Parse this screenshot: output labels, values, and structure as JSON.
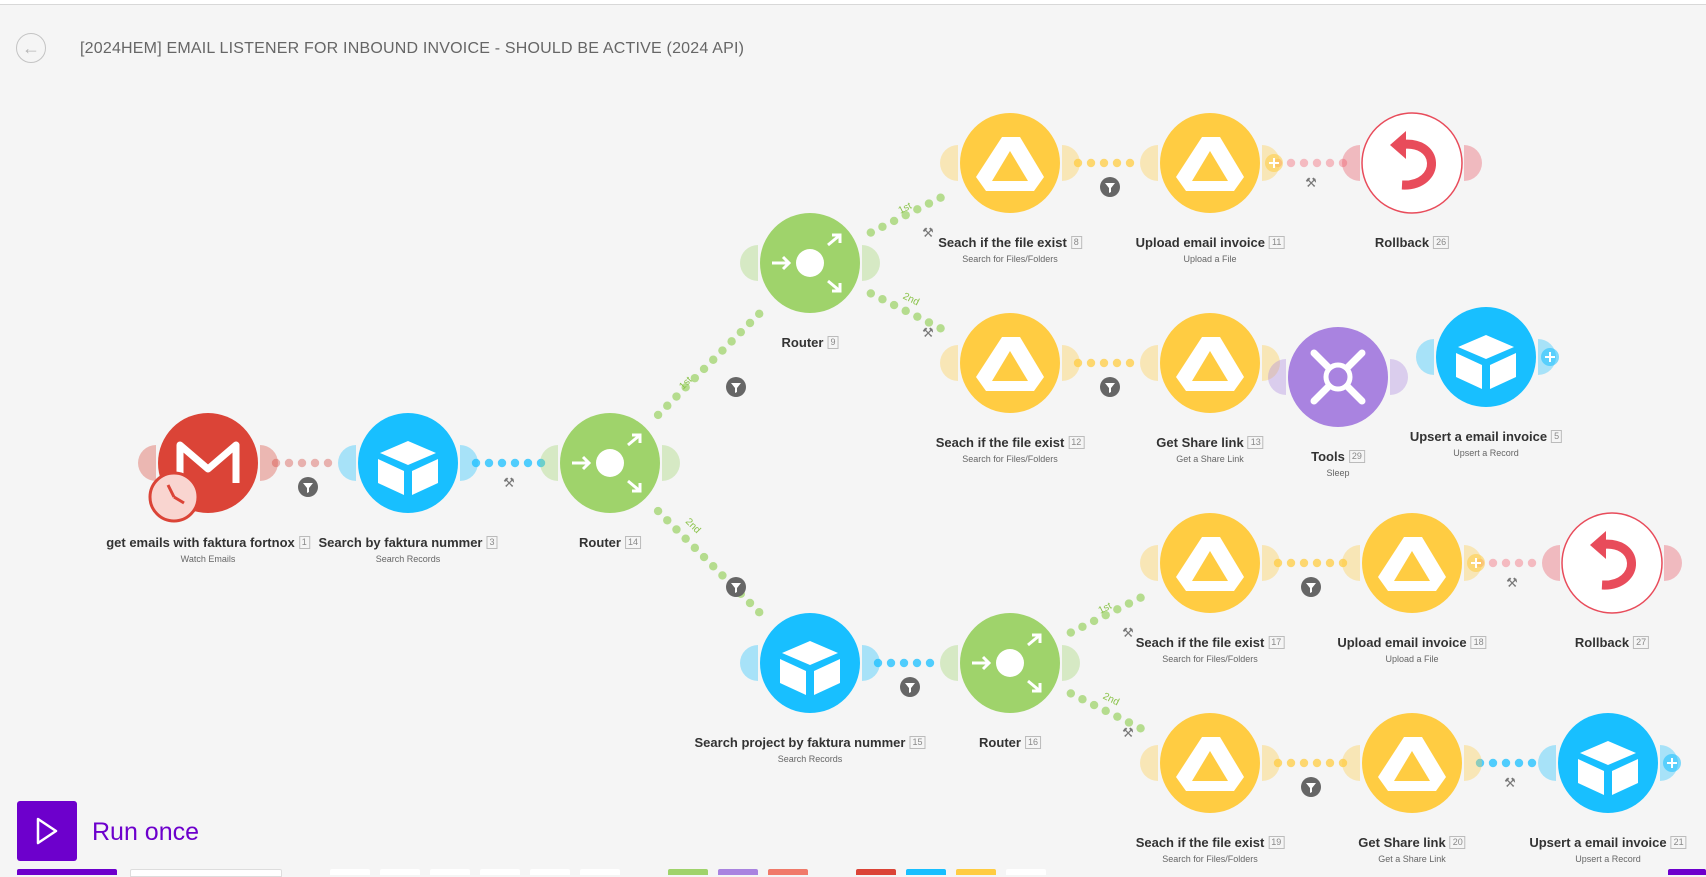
{
  "header": {
    "title": "[2024HEM] EMAIL LISTENER FOR INBOUND INVOICE - SHOULD BE ACTIVE (2024 API)",
    "back_icon": "arrow-left-icon"
  },
  "colors": {
    "gmail": "#db4437",
    "airtable": "#18bfff",
    "router": "#9fd36b",
    "drive": "#ffcc42",
    "tools": "#a983e0",
    "rollback": "#e84c5b",
    "accent": "#6d00cc"
  },
  "modules": [
    {
      "key": "gmail",
      "name": "get emails with faktura fortnox",
      "id": "1",
      "sub": "Watch Emails",
      "icon": "gmail-icon"
    },
    {
      "key": "at3",
      "name": "Search by faktura nummer",
      "id": "3",
      "sub": "Search Records",
      "icon": "airtable-icon"
    },
    {
      "key": "r14",
      "name": "Router",
      "id": "14",
      "sub": "",
      "icon": "router-icon"
    },
    {
      "key": "r9",
      "name": "Router",
      "id": "9",
      "sub": "",
      "icon": "router-icon"
    },
    {
      "key": "d8",
      "name": "Seach if the file exist",
      "id": "8",
      "sub": "Search for Files/Folders",
      "icon": "google-drive-icon"
    },
    {
      "key": "d11",
      "name": "Upload email invoice",
      "id": "11",
      "sub": "Upload a File",
      "icon": "google-drive-icon"
    },
    {
      "key": "rb26",
      "name": "Rollback",
      "id": "26",
      "sub": "",
      "icon": "rollback-icon"
    },
    {
      "key": "d12",
      "name": "Seach if the file exist",
      "id": "12",
      "sub": "Search for Files/Folders",
      "icon": "google-drive-icon"
    },
    {
      "key": "d13",
      "name": "Get Share link",
      "id": "13",
      "sub": "Get a Share Link",
      "icon": "google-drive-icon"
    },
    {
      "key": "t29",
      "name": "Tools",
      "id": "29",
      "sub": "Sleep",
      "icon": "tools-icon"
    },
    {
      "key": "at5",
      "name": "Upsert a email invoice",
      "id": "5",
      "sub": "Upsert a Record",
      "icon": "airtable-icon"
    },
    {
      "key": "at15",
      "name": "Search project by faktura nummer",
      "id": "15",
      "sub": "Search Records",
      "icon": "airtable-icon"
    },
    {
      "key": "r16",
      "name": "Router",
      "id": "16",
      "sub": "",
      "icon": "router-icon"
    },
    {
      "key": "d17",
      "name": "Seach if the file exist",
      "id": "17",
      "sub": "Search for Files/Folders",
      "icon": "google-drive-icon"
    },
    {
      "key": "d18",
      "name": "Upload email invoice",
      "id": "18",
      "sub": "Upload a File",
      "icon": "google-drive-icon"
    },
    {
      "key": "rb27",
      "name": "Rollback",
      "id": "27",
      "sub": "",
      "icon": "rollback-icon"
    },
    {
      "key": "d19",
      "name": "Seach if the file exist",
      "id": "19",
      "sub": "Search for Files/Folders",
      "icon": "google-drive-icon"
    },
    {
      "key": "d20",
      "name": "Get Share link",
      "id": "20",
      "sub": "Get a Share Link",
      "icon": "google-drive-icon"
    },
    {
      "key": "at21",
      "name": "Upsert a email invoice",
      "id": "21",
      "sub": "Upsert a Record",
      "icon": "airtable-icon"
    }
  ],
  "route_labels": {
    "first": "1st",
    "second": "2nd"
  },
  "run": {
    "label": "Run once",
    "icon": "play-icon"
  }
}
